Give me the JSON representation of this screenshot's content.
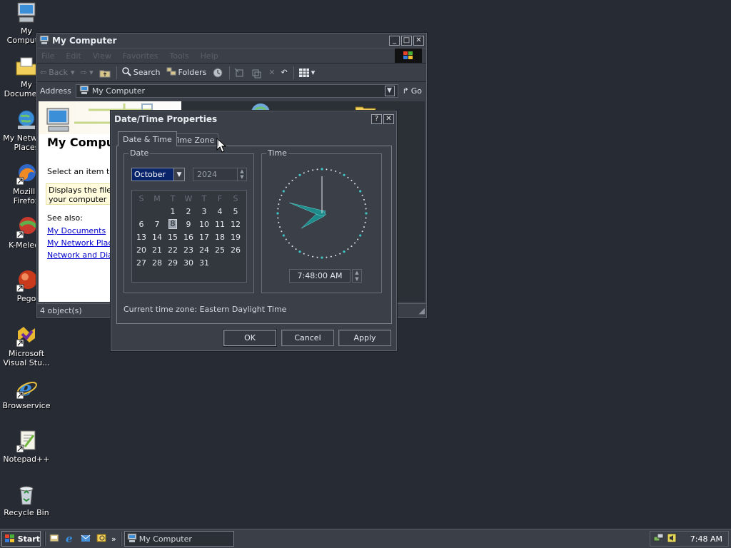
{
  "desktop": {
    "icons": [
      {
        "label": "My Computer",
        "icon": "my-computer-icon"
      },
      {
        "label": "My Documents",
        "icon": "my-documents-icon"
      },
      {
        "label": "My Network Places",
        "icon": "network-places-icon"
      },
      {
        "label": "Mozilla Firefox",
        "icon": "firefox-icon"
      },
      {
        "label": "K-Meleon",
        "icon": "k-meleon-icon"
      },
      {
        "label": "Pego",
        "icon": "pego-icon"
      },
      {
        "label": "Microsoft Visual Stu...",
        "icon": "visual-studio-icon"
      },
      {
        "label": "Browservice",
        "icon": "internet-explorer-icon"
      },
      {
        "label": "Notepad++",
        "icon": "notepad-plus-plus-icon"
      },
      {
        "label": "Recycle Bin",
        "icon": "recycle-bin-icon"
      }
    ]
  },
  "explorer": {
    "title": "My Computer",
    "menu": [
      "File",
      "Edit",
      "View",
      "Favorites",
      "Tools",
      "Help"
    ],
    "toolbar": {
      "back": "Back",
      "search": "Search",
      "folders": "Folders"
    },
    "address_label": "Address",
    "address_value": "My Computer",
    "go": "Go",
    "panel_title": "My Computer",
    "select_text": "Select an item to view its description.",
    "info_text": "Displays the files and folders on your computer",
    "see_also": "See also:",
    "links": [
      "My Documents",
      "My Network Places",
      "Network and Dial-up Connections"
    ],
    "status": "4 object(s)"
  },
  "dialog": {
    "title": "Date/Time Properties",
    "help": "?",
    "close": "✕",
    "tabs": [
      "Date & Time",
      "Time Zone"
    ],
    "date_group": "Date",
    "month": "October",
    "year": "2024",
    "weekdays": [
      "S",
      "M",
      "T",
      "W",
      "T",
      "F",
      "S"
    ],
    "weeks": [
      [
        "",
        "",
        "1",
        "2",
        "3",
        "4",
        "5"
      ],
      [
        "6",
        "7",
        "8",
        "9",
        "10",
        "11",
        "12"
      ],
      [
        "13",
        "14",
        "15",
        "16",
        "17",
        "18",
        "19"
      ],
      [
        "20",
        "21",
        "22",
        "23",
        "24",
        "25",
        "26"
      ],
      [
        "27",
        "28",
        "29",
        "30",
        "31",
        "",
        ""
      ]
    ],
    "selected_day": "8",
    "time_group": "Time",
    "time_value": "7:48:00 AM",
    "clock": {
      "hour": 7,
      "minute": 48,
      "second": 0
    },
    "timezone_line": "Current time zone:  Eastern Daylight Time",
    "buttons": {
      "ok": "OK",
      "cancel": "Cancel",
      "apply": "Apply"
    }
  },
  "taskbar": {
    "start": "Start",
    "task": "My Computer",
    "clock": "7:48 AM",
    "chevron": "»"
  },
  "colors": {
    "desktop": "#272b33",
    "window": "#3a3f48",
    "accent": "#0a246a",
    "clock_hands": "#1f8a8a"
  }
}
